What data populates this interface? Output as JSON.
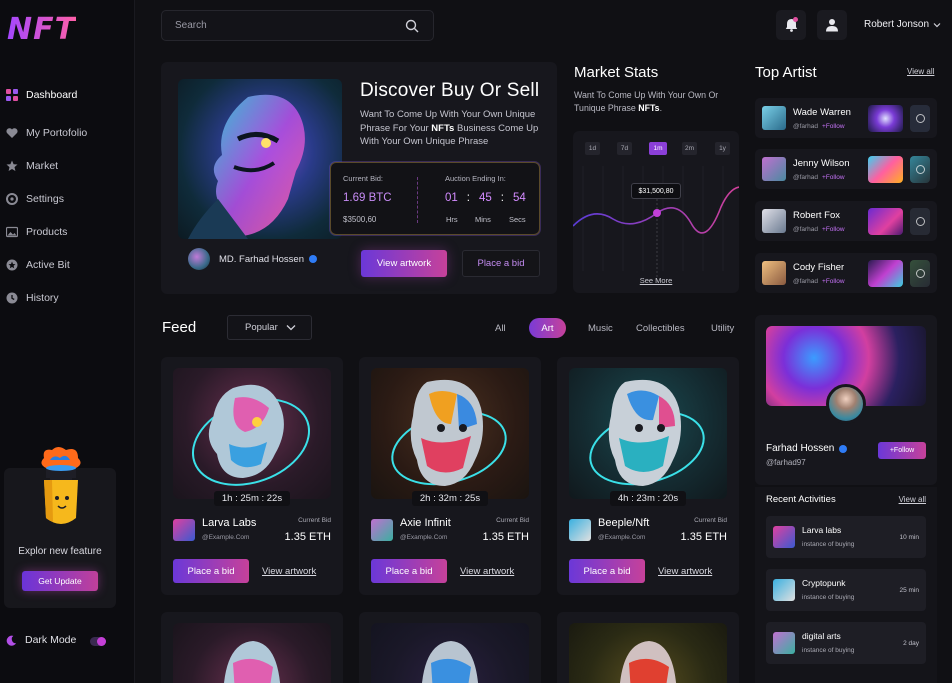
{
  "app": {
    "logo": "NFT"
  },
  "sidebar": {
    "items": [
      {
        "label": "Dashboard",
        "icon": "grid-icon",
        "active": true
      },
      {
        "label": "My Portofolio",
        "icon": "heart-icon"
      },
      {
        "label": "Market",
        "icon": "star-icon"
      },
      {
        "label": "Settings",
        "icon": "gear-icon"
      },
      {
        "label": "Products",
        "icon": "image-icon"
      },
      {
        "label": "Active Bit",
        "icon": "badge-icon"
      },
      {
        "label": "History",
        "icon": "clock-icon"
      }
    ],
    "promo": {
      "text": "Explor new feature",
      "button": "Get Update"
    },
    "dark_mode": {
      "label": "Dark Mode",
      "enabled": true
    }
  },
  "header": {
    "search_placeholder": "Search",
    "username": "Robert Jonson"
  },
  "hero": {
    "title": "Discover Buy Or Sell",
    "desc_before": "Want To Come Up With Your Own Unique Phrase For Your ",
    "desc_bold": "NFTs",
    "desc_after": " Business Come Up With Your Own Unique Phrase",
    "current_bid_label": "Current Bid:",
    "current_bid_value": "1.69  BTC",
    "current_bid_usd": "$3500,60",
    "auction_label": "Auction Ending In:",
    "countdown": {
      "hrs": "01",
      "mins": "45",
      "secs": "54",
      "hrs_label": "Hrs",
      "mins_label": "Mins",
      "secs_label": "Secs"
    },
    "owner": "MD. Farhad Hossen",
    "view_button": "View artwork",
    "bid_button": "Place a bid"
  },
  "market_stats": {
    "title": "Market Stats",
    "desc_before": "Want To Come Up With Your Own Or Tunique Phrase ",
    "desc_bold": "NFTs",
    "desc_after": ".",
    "tabs": [
      "1d",
      "7d",
      "1m",
      "2m",
      "1y"
    ],
    "active_tab": "1m",
    "price_label": "$31,500,80",
    "see_more": "See More"
  },
  "top_artist": {
    "title": "Top Artist",
    "view_all": "View all",
    "artists": [
      {
        "name": "Wade Warren",
        "handle": "@farhad",
        "follow": "+Follow"
      },
      {
        "name": "Jenny Wilson",
        "handle": "@farhad",
        "follow": "+Follow"
      },
      {
        "name": "Robert Fox",
        "handle": "@farhad",
        "follow": "+Follow"
      },
      {
        "name": "Cody Fisher",
        "handle": "@farhad",
        "follow": "+Follow"
      }
    ]
  },
  "feed": {
    "title": "Feed",
    "sort": "Popular",
    "filters": [
      "All",
      "Art",
      "Music",
      "Collectibles",
      "Utility"
    ],
    "active_filter": "Art",
    "cards": [
      {
        "name": "Larva Labs",
        "email": "@Example.Com",
        "bid_label": "Current Bid",
        "bid": "1.35 ETH",
        "timer": "1h : 25m : 22s",
        "place_bid": "Place a bid",
        "view": "View artwork"
      },
      {
        "name": "Axie Infinit",
        "email": "@Example.Com",
        "bid_label": "Current Bid",
        "bid": "1.35 ETH",
        "timer": "2h : 32m : 25s",
        "place_bid": "Place a bid",
        "view": "View artwork"
      },
      {
        "name": "Beeple/Nft",
        "email": "@Example.Com",
        "bid_label": "Current Bid",
        "bid": "1.35 ETH",
        "timer": "4h : 23m : 20s",
        "place_bid": "Place a bid",
        "view": "View artwork"
      }
    ]
  },
  "profile": {
    "name": "Farhad Hossen",
    "handle": "@farhad97",
    "follow": "+Follow"
  },
  "recent": {
    "title": "Recent Activities",
    "view_all": "View all",
    "items": [
      {
        "name": "Larva labs",
        "desc": "instance of buying",
        "time": "10 min"
      },
      {
        "name": "Cryptopunk",
        "desc": "instance of buying",
        "time": "25 min"
      },
      {
        "name": "digital arts",
        "desc": "instance of buying",
        "time": "2 day"
      }
    ]
  },
  "colors": {
    "accent_start": "#6b38d8",
    "accent_end": "#c6419a",
    "bg": "#101014",
    "card": "#17171d"
  }
}
